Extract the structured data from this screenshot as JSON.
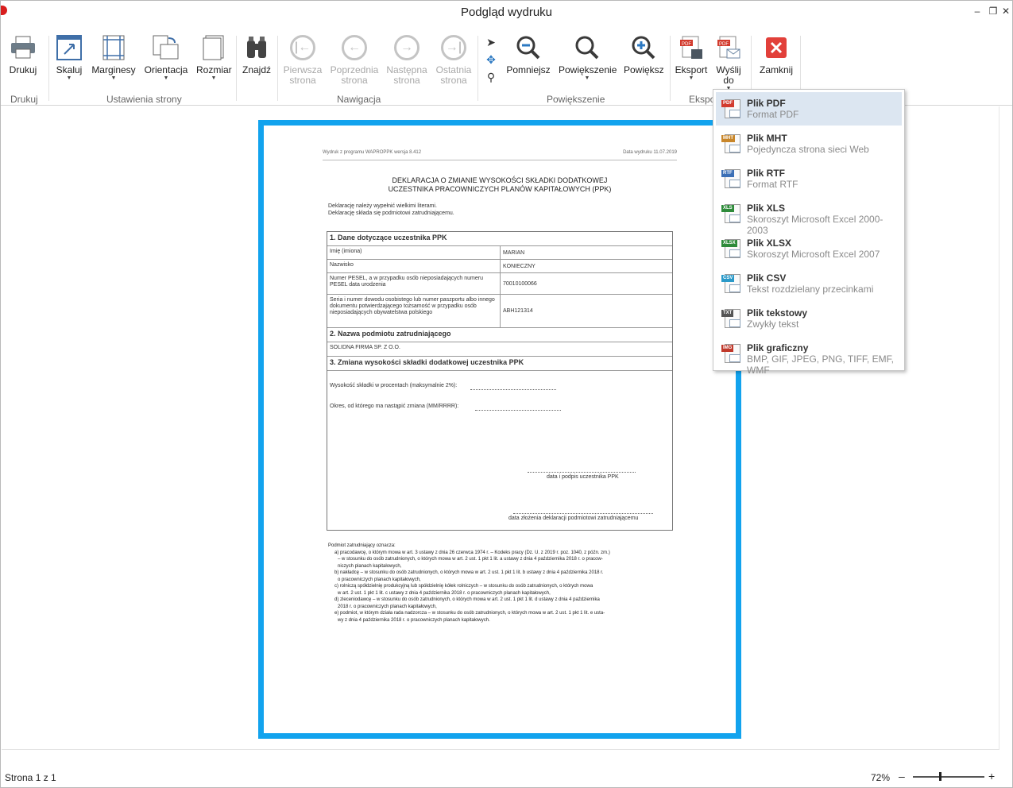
{
  "window": {
    "title": "Podgląd wydruku",
    "min_icon": "minimize-icon",
    "max_icon": "restore-icon",
    "close_icon": "close-icon"
  },
  "ribbon": {
    "drukuj": "Drukuj",
    "skaluj": "Skaluj",
    "marginesy": "Marginesy",
    "orientacja": "Orientacja",
    "rozmiar": "Rozmiar",
    "znajdz": "Znajdź",
    "pierwsza": "Pierwsza strona",
    "poprzednia": "Poprzednia strona",
    "nastepna": "Następna strona",
    "ostatnia": "Ostatnia strona",
    "pomniejsz": "Pomniejsz",
    "powiekszenie": "Powiększenie",
    "powieksz": "Powiększ",
    "eksport": "Eksport",
    "wyslij": "Wyślij do",
    "zamknij": "Zamknij",
    "groups": {
      "drukuj": "Drukuj",
      "ustawienia": "Ustawienia strony",
      "nawigacja": "Nawigacja",
      "powiekszenie": "Powiększenie",
      "eksport": "Ekspo"
    }
  },
  "document": {
    "header_left": "Wydruk z programu WAPROPPK wersja 8.412",
    "header_right": "Data wydruku 11.07.2019",
    "title_line1": "DEKLARACJA O ZMIANIE WYSOKOŚCI SKŁADKI DODATKOWEJ",
    "title_line2": "UCZESTNIKA PRACOWNICZYCH PLANÓW KAPITAŁOWYCH (PPK)",
    "intro_line1": "Deklarację należy wypełnić wielkimi literami.",
    "intro_line2": "Deklarację składa się podmiotowi zatrudniającemu.",
    "section1": "1. Dane dotyczące uczestnika PPK",
    "rows": [
      {
        "label": "Imię (imiona)",
        "value": "MARIAN"
      },
      {
        "label": "Nazwisko",
        "value": "KONIECZNY"
      },
      {
        "label": "Numer PESEL, a w przypadku osób nieposiadających numeru PESEL data urodzenia",
        "value": "70010100066"
      },
      {
        "label": "Seria i numer dowodu osobistego lub numer paszportu albo innego dokumentu potwierdzającego tożsamość w przypadku osób nieposiadających obywatelstwa polskiego",
        "value": "ABH121314"
      }
    ],
    "section2": "2. Nazwa podmiotu zatrudniającego",
    "employer": "SOLIDNA FIRMA SP. Z O.O.",
    "section3": "3. Zmiana wysokości składki dodatkowej uczestnika PPK",
    "rate_line": "Wysokość składki w procentach (maksymalnie 2%):",
    "period_line": "Okres, od którego ma nastąpić zmiana (MM/RRRR):",
    "sign1": "data i podpis uczestnika PPK",
    "sign2": "data złożenia deklaracji podmiotowi zatrudniającemu",
    "footnotes": [
      "Podmiot zatrudniający oznacza:",
      "a) pracodawcę, o którym mowa w art. 3 ustawy z dnia 26 czerwca 1974 r. – Kodeks pracy (Dz. U. z 2019 r. poz. 1040, z późn. zm.)",
      "– w stosunku do osób zatrudnionych, o których mowa w art. 2 ust. 1 pkt 1 lit. a ustawy z dnia 4 października 2018 r. o pracow-",
      "niczych planach kapitałowych,",
      "b) nakładcę – w stosunku do osób zatrudnionych, o których mowa w art. 2 ust. 1 pkt 1 lit. b ustawy z dnia 4 października 2018 r.",
      "o pracowniczych planach kapitałowych,",
      "c) rolniczą spółdzielnię produkcyjną lub spółdzielnię kółek rolniczych – w stosunku do osób zatrudnionych, o których mowa",
      "w art. 2 ust. 1 pkt 1 lit. c ustawy z dnia 4 października 2018 r. o pracowniczych planach kapitałowych,",
      "d) zleceniodawcę – w stosunku do osób zatrudnionych, o których mowa w art. 2 ust. 1 pkt 1 lit. d ustawy z dnia 4 października",
      "2018 r. o pracowniczych planach kapitałowych,",
      "e) podmiot, w którym działa rada nadzorcza – w stosunku do osób zatrudnionych, o których mowa w art. 2 ust. 1 pkt 1 lit. e usta-",
      "wy z dnia 4 października 2018 r. o pracowniczych planach kapitałowych."
    ]
  },
  "dropdown": [
    {
      "tag": "PDF",
      "tag_color": "#d23b2e",
      "title": "Plik PDF",
      "sub": "Format PDF"
    },
    {
      "tag": "MHT",
      "tag_color": "#c8862a",
      "title": "Plik MHT",
      "sub": "Pojedyncza strona sieci Web"
    },
    {
      "tag": "RTF",
      "tag_color": "#3b6fb6",
      "title": "Plik RTF",
      "sub": "Format RTF"
    },
    {
      "tag": "XLS",
      "tag_color": "#2e8b3a",
      "title": "Plik XLS",
      "sub": "Skoroszyt Microsoft Excel 2000-2003"
    },
    {
      "tag": "XLSX",
      "tag_color": "#2e8b3a",
      "title": "Plik XLSX",
      "sub": "Skoroszyt Microsoft Excel 2007"
    },
    {
      "tag": "CSV",
      "tag_color": "#2b9ac9",
      "title": "Plik CSV",
      "sub": "Tekst rozdzielany przecinkami"
    },
    {
      "tag": "TXT",
      "tag_color": "#555555",
      "title": "Plik tekstowy",
      "sub": "Zwykły tekst"
    },
    {
      "tag": "IMG",
      "tag_color": "#c0392b",
      "title": "Plik graficzny",
      "sub": "BMP, GIF, JPEG, PNG, TIFF, EMF, WMF"
    }
  ],
  "status": {
    "page": "Strona 1 z 1",
    "zoom": "72%",
    "zoom_level": 0.38
  },
  "colors": {
    "page_border": "#12a3ee",
    "selected_item": "#dce6f1"
  }
}
